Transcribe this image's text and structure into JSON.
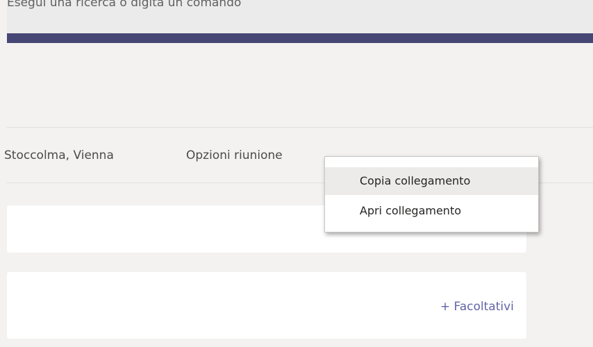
{
  "search": {
    "placeholder": "Esegui una ricerca o digita un comando"
  },
  "tabs": [
    {
      "label": "Stoccolma, Vienna"
    },
    {
      "label": "Opzioni riunione"
    }
  ],
  "context_menu": {
    "items": [
      {
        "label": "Copia collegamento",
        "highlighted": true
      },
      {
        "label": "Apri collegamento",
        "highlighted": false
      }
    ]
  },
  "form": {
    "optional_link": "+ Facoltativi"
  },
  "colors": {
    "accent": "#464775",
    "link": "#6264a7",
    "background": "#f3f2f1",
    "menu_hover": "#edebe9"
  }
}
